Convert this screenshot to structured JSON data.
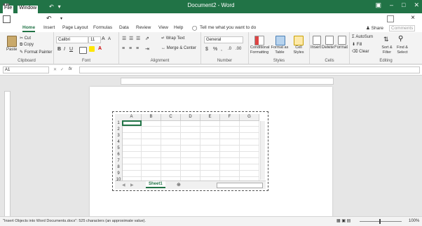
{
  "window": {
    "title": "Document2 - Word",
    "menu": [
      "File",
      "Window"
    ]
  },
  "quick_access": {
    "save_icon": "save-icon",
    "undo_icon": "undo-icon",
    "redo_icon": "redo-icon"
  },
  "tabs": [
    "Home",
    "Insert",
    "Page Layout",
    "Formulas",
    "Data",
    "Review",
    "View",
    "Help"
  ],
  "tell_me": "Tell me what you want to do",
  "share": "Share",
  "comments": "Comments",
  "ribbon": {
    "clipboard": {
      "paste": "Paste",
      "cut": "Cut",
      "copy": "Copy",
      "format_painter": "Format Painter",
      "label": "Clipboard"
    },
    "font": {
      "name": "Calibri",
      "size": "11",
      "bold": "B",
      "italic": "I",
      "underline": "U",
      "grow": "A",
      "shrink": "A",
      "label": "Font"
    },
    "alignment": {
      "wrap": "Wrap Text",
      "merge": "Merge & Center",
      "label": "Alignment"
    },
    "number": {
      "format": "General",
      "currency": "$",
      "percent": "%",
      "comma": ",",
      "label": "Number"
    },
    "styles": {
      "conditional": "Conditional Formatting",
      "format_table": "Format as Table",
      "cell_styles": "Cell Styles",
      "label": "Styles"
    },
    "cells": {
      "insert": "Insert",
      "delete": "Delete",
      "format": "Format",
      "label": "Cells"
    },
    "editing": {
      "autosum": "AutoSum",
      "fill": "Fill",
      "clear": "Clear",
      "sort": "Sort & Filter",
      "find": "Find & Select",
      "label": "Editing"
    }
  },
  "formula_bar": {
    "name_box": "A1",
    "fx": "fx",
    "value": ""
  },
  "sheet": {
    "columns": [
      "A",
      "B",
      "C",
      "D",
      "E",
      "F",
      "G"
    ],
    "rows": [
      "1",
      "2",
      "3",
      "4",
      "5",
      "6",
      "7",
      "8",
      "9",
      "10"
    ],
    "tab": "Sheet1"
  },
  "status": {
    "text": "\"Insert Objects into Word Documents.docx\": 525 characters (an approximate value).",
    "zoom": "100%"
  },
  "colors": {
    "accent": "#217346",
    "ribbon_bg": "#f3f3f3"
  }
}
